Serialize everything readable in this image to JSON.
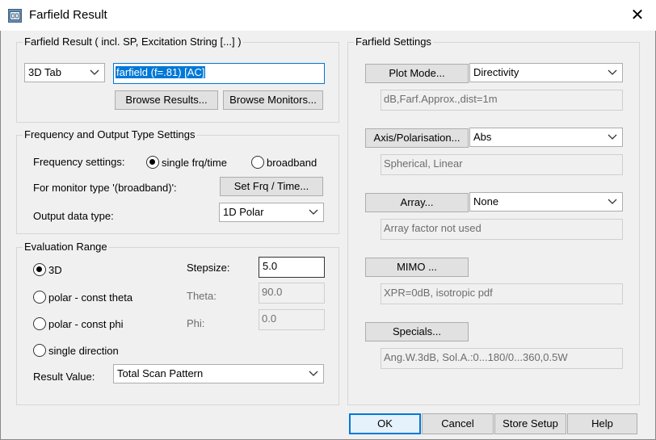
{
  "window": {
    "title": "Farfield Result",
    "icon": "farfield-app-icon",
    "close_glyph": "✕"
  },
  "result_group": {
    "label": "Farfield Result ( incl. SP, Excitation String [...] )",
    "tab_select": "3D Tab",
    "result_name": "farfield (f=.81) [AC]",
    "browse_results": "Browse Results...",
    "browse_monitors": "Browse Monitors..."
  },
  "freq_group": {
    "label": "Frequency and Output Type Settings",
    "freq_label": "Frequency settings:",
    "single_label": "single frq/time",
    "broadband_label": "broadband",
    "selected": "single",
    "monitor_label": "For monitor type '(broadband)':",
    "set_frq_button": "Set Frq / Time...",
    "output_label": "Output data type:",
    "output_value": "1D Polar"
  },
  "eval_group": {
    "label": "Evaluation Range",
    "opt_3d": "3D",
    "opt_polar_theta": "polar - const theta",
    "opt_polar_phi": "polar - const phi",
    "opt_single": "single direction",
    "selected": "3D",
    "stepsize_label": "Stepsize:",
    "stepsize_value": "5.0",
    "theta_label": "Theta:",
    "theta_value": "90.0",
    "phi_label": "Phi:",
    "phi_value": "0.0",
    "result_value_label": "Result Value:",
    "result_value": "Total Scan Pattern"
  },
  "settings_group": {
    "label": "Farfield Settings",
    "plot_mode_button": "Plot Mode...",
    "plot_mode_value": "Directivity",
    "plot_mode_info": "dB,Farf.Approx.,dist=1m",
    "axis_button": "Axis/Polarisation...",
    "axis_value": "Abs",
    "axis_info": "Spherical, Linear",
    "array_button": "Array...",
    "array_value": "None",
    "array_info": "Array factor not used",
    "mimo_button": "MIMO ...",
    "mimo_info": "XPR=0dB, isotropic pdf",
    "specials_button": "Specials...",
    "specials_info": "Ang.W.3dB, Sol.A.:0...180/0...360,0.5W"
  },
  "footer": {
    "ok": "OK",
    "cancel": "Cancel",
    "store_setup": "Store Setup",
    "help": "Help"
  },
  "colors": {
    "accent": "#0078d7",
    "window_bg": "#f0f0f0",
    "button_bg": "#e1e1e1"
  }
}
